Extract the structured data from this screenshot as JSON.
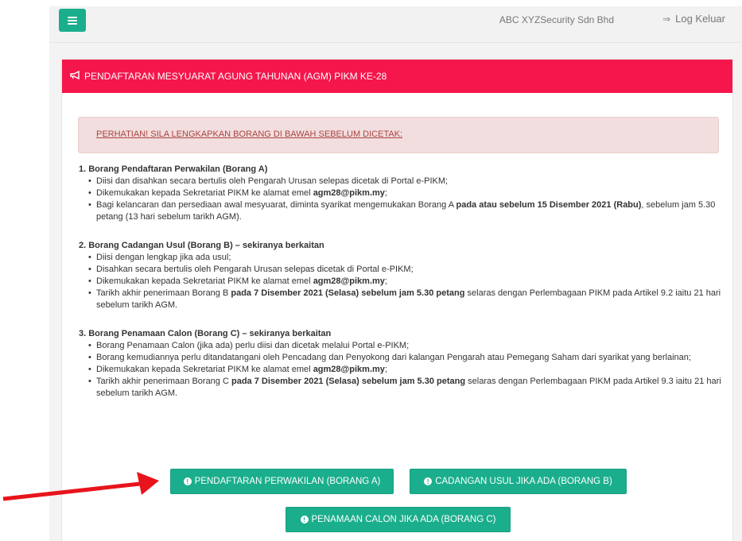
{
  "topbar": {
    "company": "ABC XYZSecurity Sdn Bhd",
    "logout_label": "Log Keluar"
  },
  "panel": {
    "title": "PENDAFTARAN MESYUARAT AGUNG TAHUNAN (AGM) PIKM KE-28"
  },
  "alert": {
    "text": "PERHATIAN! SILA LENGKAPKAN BORANG DI BAWAH SEBELUM DICETAK:"
  },
  "sections": [
    {
      "title": "1. Borang Pendaftaran Perwakilan (Borang A)",
      "items": [
        [
          "Diisi dan disahkan secara bertulis oleh Pengarah Urusan selepas dicetak di Portal e-PIKM;"
        ],
        [
          "Dikemukakan kepada Sekretariat PIKM ke alamat emel ",
          "agm28@pikm.my",
          ";"
        ],
        [
          "Bagi kelancaran dan persediaan awal mesyuarat, diminta syarikat mengemukakan Borang A ",
          "pada atau sebelum 15 Disember 2021 (Rabu)",
          ", sebelum jam 5.30 petang (13 hari sebelum tarikh AGM)."
        ]
      ]
    },
    {
      "title": "2. Borang Cadangan Usul (Borang B) – sekiranya berkaitan",
      "items": [
        [
          "Diisi dengan lengkap jika ada usul;"
        ],
        [
          "Disahkan secara bertulis oleh Pengarah Urusan selepas dicetak di Portal e-PIKM;"
        ],
        [
          "Dikemukakan kepada Sekretariat PIKM ke alamat emel ",
          "agm28@pikm.my",
          ";"
        ],
        [
          "Tarikh akhir penerimaan Borang B ",
          "pada 7 Disember 2021 (Selasa) sebelum jam 5.30 petang",
          " selaras dengan Perlembagaan PIKM pada Artikel 9.2 iaitu 21 hari sebelum tarikh AGM."
        ]
      ]
    },
    {
      "title": "3. Borang Penamaan Calon (Borang C) – sekiranya berkaitan",
      "items": [
        [
          "Borang Penamaan Calon (jika ada) perlu diisi dan dicetak melalui Portal e-PIKM;"
        ],
        [
          "Borang kemudiannya perlu ditandatangani oleh Pencadang dan Penyokong dari kalangan Pengarah atau Pemegang Saham dari syarikat yang berlainan;"
        ],
        [
          "Dikemukakan kepada Sekretariat PIKM ke alamat emel ",
          "agm28@pikm.my",
          ";"
        ],
        [
          "Tarikh akhir penerimaan Borang C ",
          "pada 7 Disember 2021 (Selasa) sebelum jam 5.30 petang",
          " selaras dengan Perlembagaan PIKM pada Artikel 9.3 iaitu 21 hari sebelum tarikh AGM."
        ]
      ]
    }
  ],
  "buttons": {
    "a": "PENDAFTARAN PERWAKILAN (BORANG A)",
    "b": "CADANGAN USUL JIKA ADA (BORANG B)",
    "c": "PENAMAAN CALON JIKA ADA (BORANG C)"
  },
  "colors": {
    "accent": "#1aae8c",
    "header": "#f5164b",
    "arrow": "#e8141c"
  }
}
